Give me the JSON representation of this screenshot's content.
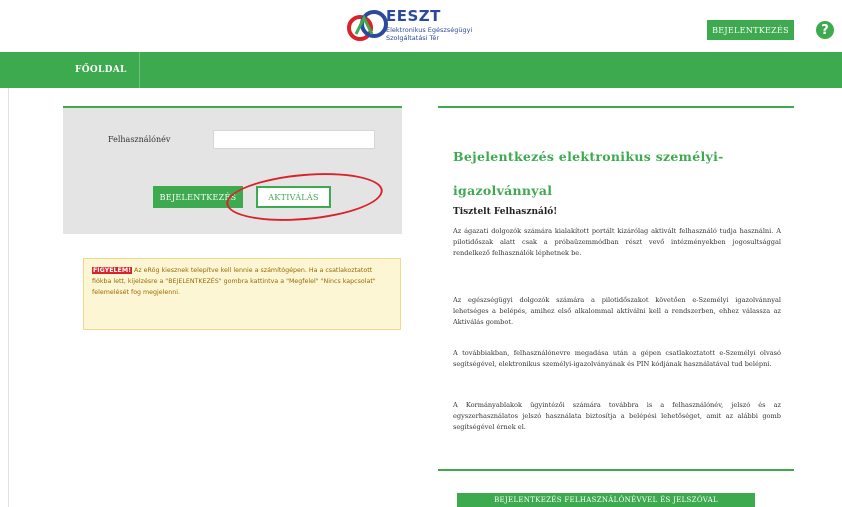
{
  "header": {
    "logo_title": "EESZT",
    "logo_subtitle": "Elektronikus Egészségügyi Szolgáltatási Tér",
    "login_button": "BEJELENTKEZÉS",
    "help_icon": "?",
    "colors": {
      "brand_green": "#3daa4f",
      "logo_blue": "#2b4a9b",
      "logo_red": "#d9232a"
    }
  },
  "nav": {
    "items": [
      {
        "label": "FŐOLDAL"
      }
    ]
  },
  "login": {
    "username_label": "Felhasználónév",
    "username_value": "",
    "login_button": "BEJELENTKEZÉS",
    "activate_button": "AKTIVÁLÁS"
  },
  "warning": {
    "tag": "FIGYELEM!",
    "text": "Az eRög kiesznek telepítve kell lennie a számítógépen. Ha a csatlakoztatott fiókba lett, kijelzésre a \"BEJELENTKEZÉS\" gombra kattintva a \"Megfelel\" \"Nincs kapcsolat\" felemelését fog megjelenni."
  },
  "info": {
    "title": "Bejelentkezés elektronikus személyi-igazolvánnyal",
    "greeting": "Tisztelt Felhasználó!",
    "paragraphs": [
      "Az ágazati dolgozók számára kialakított portált kizárólag aktivált felhasználó tudja használni. A pilotidőszak alatt csak a próbaüzemmódban részt vevő intézményekben jogosultsággal rendelkező felhasználók léphetnek be.",
      "Az egészségügyi dolgozók számára a pilotidőszakot követően e-Személyi igazolvánnyal lehetséges a belépés, amihez első alkalommal aktiválni kell a rendszerben, ehhez válassza az Aktiválás gombot.",
      "A továbbiakban, felhasználónevre megadása után a gépen csatlakoztatott e-Személyi olvasó segítségével, elektronikus személyi-igazolványának és PIN kódjának használatával tud belépni.",
      "A Kormányablakok ügyintézői számára továbbra is a felhasználónév, jelszó és az egyszerhasználatos jelszó használata biztosítja a belépési lehetőséget, amit az alábbi gomb segítségével érnek el."
    ],
    "bottom_button": "BEJELENTKEZÉS FELHASZNÁLÓNÉVVEL ÉS JELSZÓVAL"
  }
}
